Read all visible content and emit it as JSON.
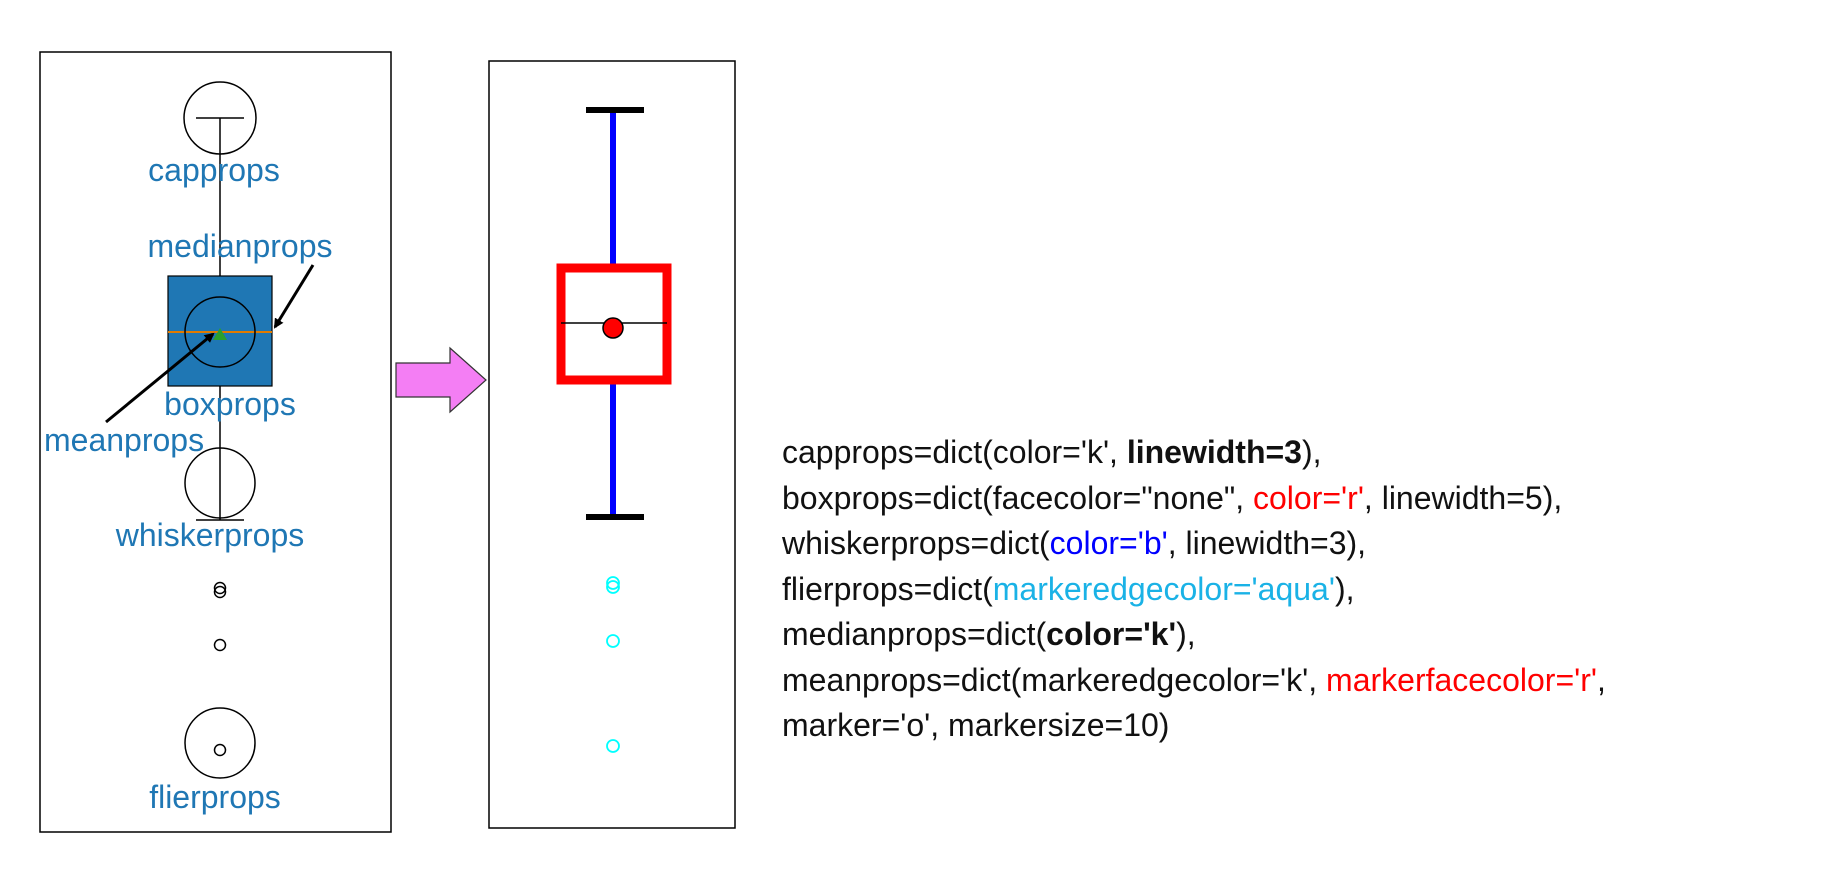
{
  "left_panel": {
    "labels": {
      "capprops": "capprops",
      "medianprops": "medianprops",
      "boxprops": "boxprops",
      "meanprops": "meanprops",
      "whiskerprops": "whiskerprops",
      "flierprops": "flierprops"
    },
    "label_color": "#1f77b4",
    "box_fill": "#1f77b4",
    "median_color": "#e07b00",
    "mean_marker_color": "#2ca02c"
  },
  "right_panel": {
    "cap_color": "#000000",
    "box_color": "#ff0000",
    "whisker_color": "#0000ff",
    "flier_color": "#00ffff",
    "median_color": "#000000",
    "mean_face_color": "#ff0000"
  },
  "arrow": {
    "fill": "#f47ef4",
    "direction": "right"
  },
  "code": {
    "lines": [
      [
        {
          "text": "capprops=dict(color='k', ",
          "color": "#111111",
          "bold": false
        },
        {
          "text": "linewidth=3",
          "color": "#111111",
          "bold": true
        },
        {
          "text": "),",
          "color": "#111111",
          "bold": false
        }
      ],
      [
        {
          "text": "boxprops=dict(facecolor=\"none\", ",
          "color": "#111111",
          "bold": false
        },
        {
          "text": "color='r'",
          "color": "#ff0000",
          "bold": false
        },
        {
          "text": ", linewidth=5),",
          "color": "#111111",
          "bold": false
        }
      ],
      [
        {
          "text": "whiskerprops=dict(",
          "color": "#111111",
          "bold": false
        },
        {
          "text": "color='b'",
          "color": "#0000ff",
          "bold": false
        },
        {
          "text": ", linewidth=3),",
          "color": "#111111",
          "bold": false
        }
      ],
      [
        {
          "text": "flierprops=dict(",
          "color": "#111111",
          "bold": false
        },
        {
          "text": "markeredgecolor='aqua'",
          "color": "#1ab2e6",
          "bold": false
        },
        {
          "text": "),",
          "color": "#111111",
          "bold": false
        }
      ],
      [
        {
          "text": "medianprops=dict(",
          "color": "#111111",
          "bold": false
        },
        {
          "text": "color='k'",
          "color": "#111111",
          "bold": true
        },
        {
          "text": "),",
          "color": "#111111",
          "bold": false
        }
      ],
      [
        {
          "text": "meanprops=dict(markeredgecolor='k', ",
          "color": "#111111",
          "bold": false
        },
        {
          "text": "markerfacecolor='r'",
          "color": "#ff0000",
          "bold": false
        },
        {
          "text": ",",
          "color": "#111111",
          "bold": false
        }
      ],
      [
        {
          "text": "marker='o', markersize=10)",
          "color": "#111111",
          "bold": false
        }
      ]
    ]
  }
}
